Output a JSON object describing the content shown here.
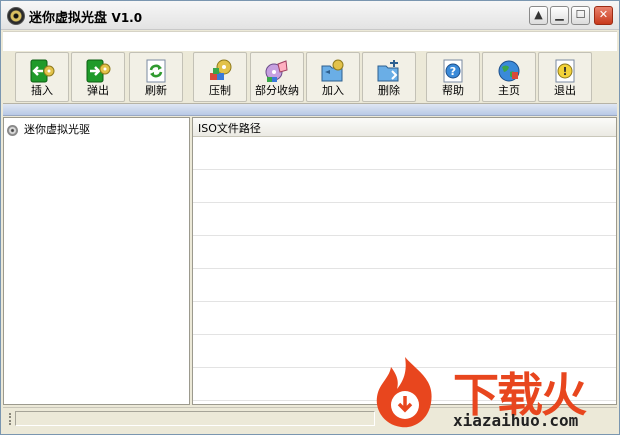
{
  "window": {
    "title": "迷你虚拟光盘 V1.0",
    "title_main": "迷你虚拟光盘",
    "title_version": "V1.0"
  },
  "toolbar": {
    "buttons": [
      {
        "label": "插入",
        "icon": "insert-disc-icon"
      },
      {
        "label": "弹出",
        "icon": "eject-disc-icon"
      },
      {
        "label": "刷新",
        "icon": "refresh-icon"
      },
      {
        "label": "压制",
        "icon": "compress-icon"
      },
      {
        "label": "部分收纳",
        "icon": "partial-collect-icon"
      },
      {
        "label": "加入",
        "icon": "add-folder-icon"
      },
      {
        "label": "删除",
        "icon": "delete-folder-icon"
      },
      {
        "label": "帮助",
        "icon": "help-icon"
      },
      {
        "label": "主页",
        "icon": "homepage-globe-icon"
      },
      {
        "label": "退出",
        "icon": "exit-icon"
      }
    ]
  },
  "tree": {
    "root_label": "迷你虚拟光驱"
  },
  "list": {
    "column_header": "ISO文件路径"
  },
  "watermark": {
    "brand": "下载火",
    "domain": "xiazaihuo.com"
  },
  "colors": {
    "accent": "#e8461e",
    "window_bg": "#ece9d8"
  }
}
